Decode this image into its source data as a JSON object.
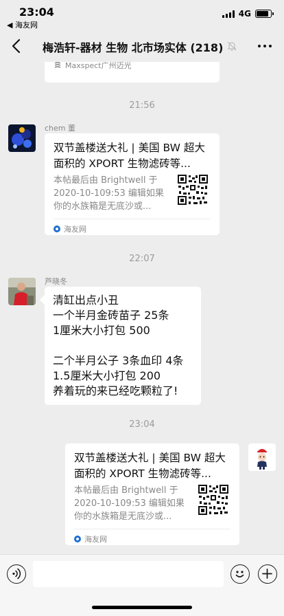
{
  "status_bar": {
    "time": "23:04",
    "back_app": "◀ 海友网",
    "network": "4G",
    "battery_level": 0.85
  },
  "nav": {
    "title": "梅浩轩-器材 生物 北市场实体 (218)"
  },
  "chat": {
    "partial_card": {
      "source": "Maxspect广州迈光"
    },
    "timestamps": [
      "21:56",
      "22:07",
      "23:04"
    ],
    "messages": [
      {
        "sender": "chem 董",
        "card": {
          "title": "双节盖楼送大礼 | 美国 BW 超大面积的 XPORT 生物滤砖等...",
          "desc": "本帖最后由 Brightwell 于 2020-10-109:53 编辑如果你的水族箱是无底沙或...",
          "source": "海友网"
        }
      },
      {
        "sender": "芦晓冬",
        "text_lines": [
          "清缸出点小丑",
          "一个半月金砖苗子 25条",
          "1厘米大小打包 500",
          "",
          "二个半月公子 3条血印 4条",
          "1.5厘米大小打包 200",
          "养着玩的来已经吃颗粒了!"
        ]
      },
      {
        "sender": "me",
        "card": {
          "title": "双节盖楼送大礼 | 美国 BW 超大面积的 XPORT 生物滤砖等...",
          "desc": "本帖最后由 Brightwell 于 2020-10-109:53 编辑如果你的水族箱是无底沙或...",
          "source": "海友网"
        }
      }
    ]
  },
  "input_bar": {
    "placeholder": ""
  }
}
